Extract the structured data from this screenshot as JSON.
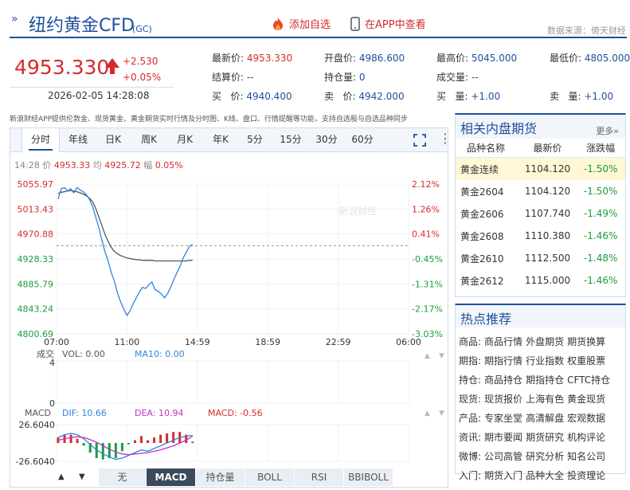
{
  "header": {
    "title": "纽约黄金CFD",
    "code": "(GC)",
    "add_fav": "添加自选",
    "app_view": "在APP中查看",
    "source": "数据来源：倚天财经"
  },
  "quote": {
    "price": "4953.330",
    "change": "+2.530",
    "change_pct": "+0.05%",
    "timestamp": "2026-02-05 14:28:08",
    "latest_label": "最新价:",
    "latest": "4953.330",
    "open_label": "开盘价:",
    "open": "4986.600",
    "high_label": "最高价:",
    "high": "5045.000",
    "low_label": "最低价:",
    "low": "4805.000",
    "settle_label": "结算价:",
    "settle": "--",
    "oi_label": "持仓量:",
    "oi": "0",
    "vol_label": "成交量:",
    "vol": "--",
    "bid_label": "买   价:",
    "bid": "4940.400",
    "ask_label": "卖   价:",
    "ask": "4942.000",
    "bidq_label": "买   量:",
    "bidq": "+1.00",
    "askq_label": "卖   量:",
    "askq": "+1.00"
  },
  "notice": "新浪财经APP提供伦敦金、现货黄金、黄金期货实时行情及分时图、K线、盘口、行情提醒等功能，支持自选股与自选品种同步",
  "chart_tabs": [
    "分时",
    "年线",
    "日K",
    "周K",
    "月K",
    "年K",
    "5分",
    "15分",
    "30分",
    "60分"
  ],
  "info_line": {
    "time": "14:28",
    "price_label": "价",
    "price": "4953.33",
    "avg_label": "均",
    "avg": "4925.72",
    "amp_label": "幅",
    "amp": "0.05%"
  },
  "chart_data": {
    "type": "line",
    "y_ticks_left": [
      "5055.97",
      "5013.43",
      "4970.88",
      "4928.33",
      "4885.79",
      "4843.24",
      "4800.69"
    ],
    "y_ticks_right": [
      "2.12%",
      "1.26%",
      "0.41%",
      "-0.45%",
      "-1.31%",
      "-2.17%",
      "-3.03%"
    ],
    "x_ticks": [
      "07:00",
      "11:00",
      "14:59",
      "18:59",
      "22:59",
      "06:00"
    ],
    "ylim": [
      4800.69,
      5055.97
    ],
    "prev_close": 4950.8,
    "series": [
      {
        "values": [
          5030,
          5048,
          5050,
          5044,
          5048,
          5041,
          5050,
          5046,
          5043,
          5038,
          5030,
          5018,
          5000,
          4982,
          4960,
          4940,
          4925,
          4905,
          4890,
          4870,
          4855,
          4843,
          4832,
          4840,
          4852,
          4862,
          4872,
          4880,
          4878,
          4884,
          4889,
          4876,
          4873,
          4869,
          4862,
          4869,
          4880,
          4893,
          4905,
          4916,
          4930,
          4940,
          4950,
          4953
        ]
      },
      {
        "values": [
          5040,
          5042,
          5043,
          5044,
          5045,
          5044,
          5043,
          5041,
          5039,
          5036,
          5032,
          5026,
          5015,
          5000,
          4985,
          4970,
          4958,
          4948,
          4941,
          4937,
          4934,
          4932,
          4930,
          4929,
          4928,
          4927,
          4927,
          4926,
          4926,
          4926,
          4926,
          4925,
          4925,
          4925,
          4925,
          4925,
          4925,
          4925,
          4925,
          4925,
          4925,
          4925,
          4926,
          4926
        ]
      }
    ]
  },
  "volume_panel": {
    "label": "成交",
    "vol": "VOL: 0.00",
    "ma": "MA10: 0.00",
    "ymax": "4",
    "ymin": "0"
  },
  "macd_panel": {
    "label": "MACD",
    "dif": "DIF: 10.66",
    "dea": "DEA: 10.94",
    "macd": "MACD: -0.56",
    "ymax": "26.6040",
    "ymin": "-26.6040",
    "dif_values": [
      8,
      12,
      14,
      12,
      6,
      -2,
      -10,
      -16,
      -20,
      -24,
      -22,
      -18,
      -14,
      -10,
      -12,
      -8,
      -4,
      0,
      4,
      8,
      10,
      11
    ],
    "dea_values": [
      4,
      6,
      8,
      9,
      8,
      5,
      1,
      -4,
      -9,
      -13,
      -16,
      -17,
      -16,
      -15,
      -14,
      -12,
      -10,
      -7,
      -4,
      0,
      4,
      10
    ],
    "hist_values": [
      8,
      12,
      12,
      6,
      -4,
      -14,
      -22,
      -24,
      -22,
      -22,
      -12,
      -2,
      4,
      10,
      4,
      8,
      12,
      14,
      16,
      16,
      12,
      2
    ]
  },
  "bottom_tabs": [
    "无",
    "MACD",
    "持仓量",
    "BOLL",
    "RSI",
    "BBIBOLL"
  ],
  "related": {
    "title": "相关内盘期货",
    "more": "更多»",
    "headers": [
      "品种名称",
      "最新价",
      "涨跌幅"
    ],
    "rows": [
      {
        "name": "黄金连续",
        "price": "1104.120",
        "pct": "-1.50%"
      },
      {
        "name": "黄金2604",
        "price": "1104.120",
        "pct": "-1.50%"
      },
      {
        "name": "黄金2606",
        "price": "1107.740",
        "pct": "-1.49%"
      },
      {
        "name": "黄金2608",
        "price": "1110.380",
        "pct": "-1.46%"
      },
      {
        "name": "黄金2610",
        "price": "1112.500",
        "pct": "-1.48%"
      },
      {
        "name": "黄金2612",
        "price": "1115.000",
        "pct": "-1.46%"
      }
    ]
  },
  "hot": {
    "title": "热点推荐",
    "rows": [
      {
        "k": "商品:",
        "links": [
          "商品行情",
          "外盘期货",
          "期货换算"
        ]
      },
      {
        "k": "期指:",
        "links": [
          "期指行情",
          "行业指数",
          "权重股票"
        ]
      },
      {
        "k": "持仓:",
        "links": [
          "商品持仓",
          "期指持仓",
          "CFTC持仓"
        ]
      },
      {
        "k": "现货:",
        "links": [
          "现货报价",
          "上海有色",
          "黄金现货"
        ]
      },
      {
        "k": "产品:",
        "links": [
          "专家坐堂",
          "高清解盘",
          "宏观数据"
        ]
      },
      {
        "k": "资讯:",
        "links": [
          "期市要闻",
          "期货研究",
          "机构评论"
        ]
      },
      {
        "k": "微博:",
        "links": [
          "公司高管",
          "研究分析",
          "知名公司"
        ]
      },
      {
        "k": "入门:",
        "links": [
          "期货入门",
          "品种大全",
          "投资理论"
        ]
      }
    ]
  },
  "colors": {
    "accent": "#1f4f9c",
    "up": "#d52b2b",
    "down": "#1a9e3a",
    "price_line": "#2e86de",
    "avg_line": "#555555"
  }
}
